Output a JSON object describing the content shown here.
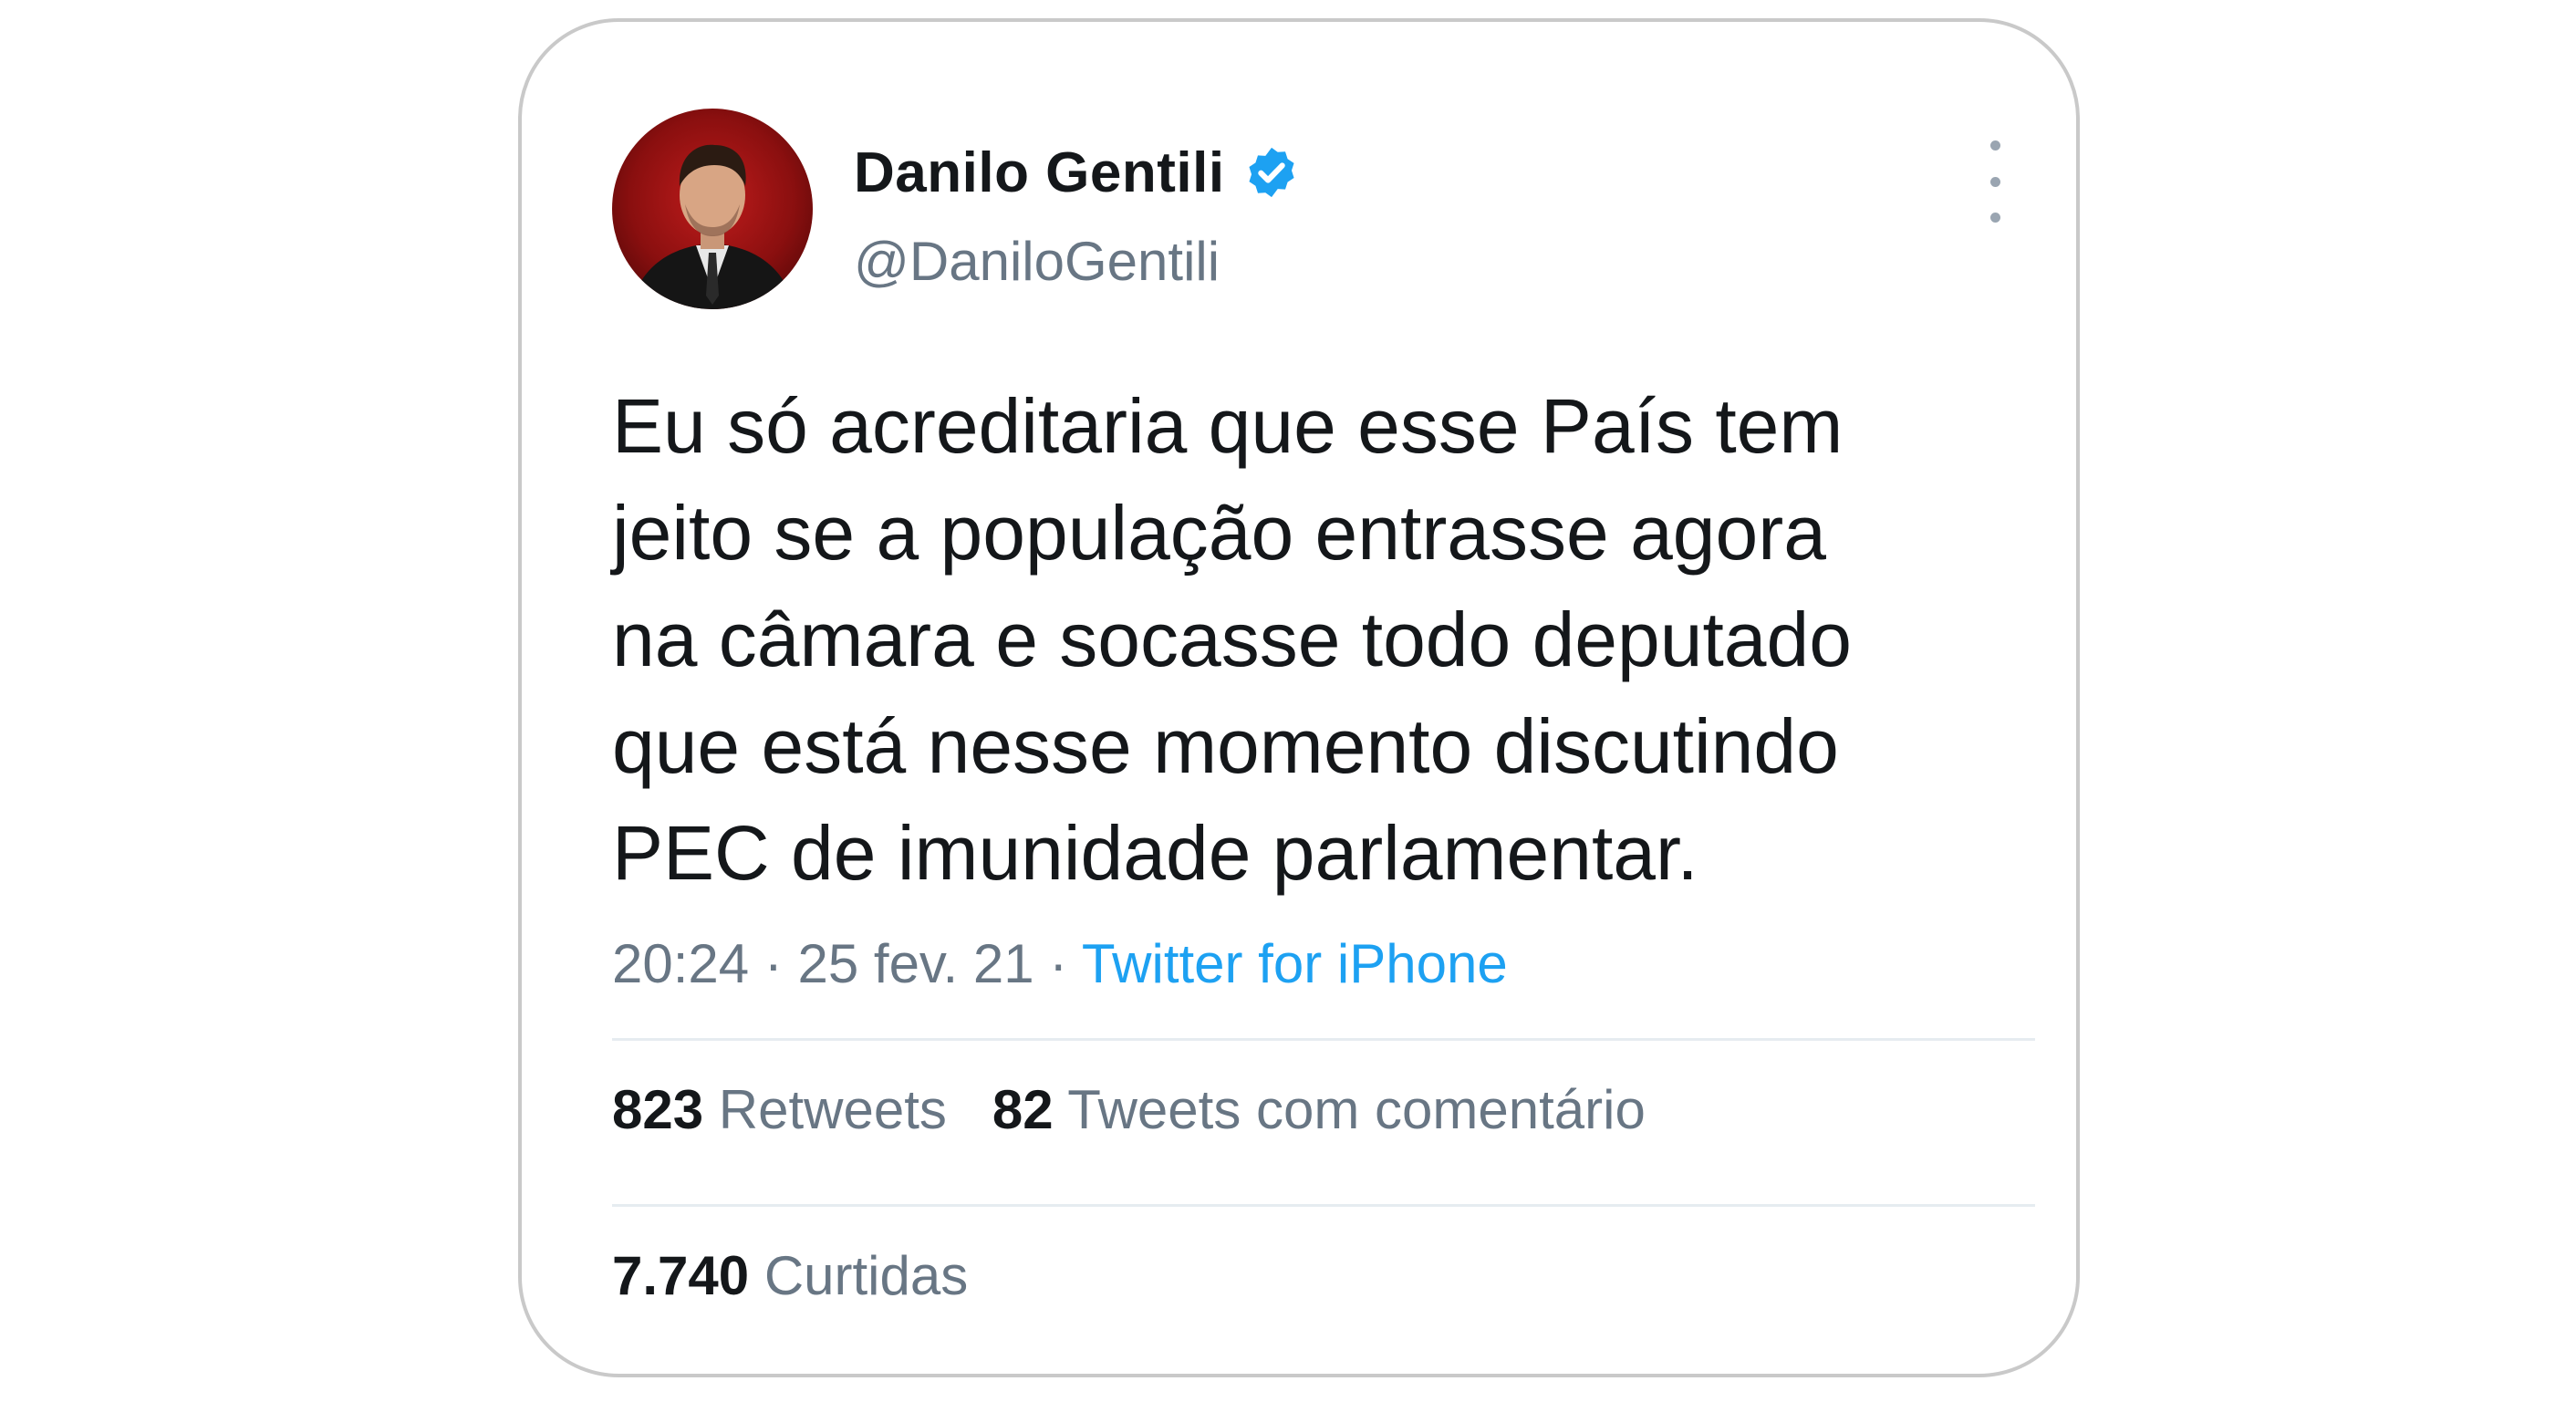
{
  "tweet": {
    "author_name": "Danilo Gentili",
    "handle": "@DaniloGentili",
    "lines": [
      "Eu só acreditaria que esse País tem",
      "jeito se a população entrasse agora",
      "na câmara e socasse todo deputado",
      "que está nesse momento discutindo",
      "PEC de imunidade parlamentar."
    ],
    "time": "20:24",
    "date": "25 fev. 21",
    "separator": " · ",
    "source": "Twitter for iPhone"
  },
  "stats": {
    "retweets_count": "823",
    "retweets_label": "Retweets",
    "quotes_count": "82",
    "quotes_label": "Tweets com comentário",
    "likes_count": "7.740",
    "likes_label": "Curtidas"
  },
  "icons": {
    "verified": "verified-badge-icon",
    "more": "more-options-icon"
  },
  "colors": {
    "verified_blue": "#1da1f2",
    "link_blue": "#1da1f2",
    "secondary_text": "#687684",
    "primary_text": "#14171a"
  }
}
